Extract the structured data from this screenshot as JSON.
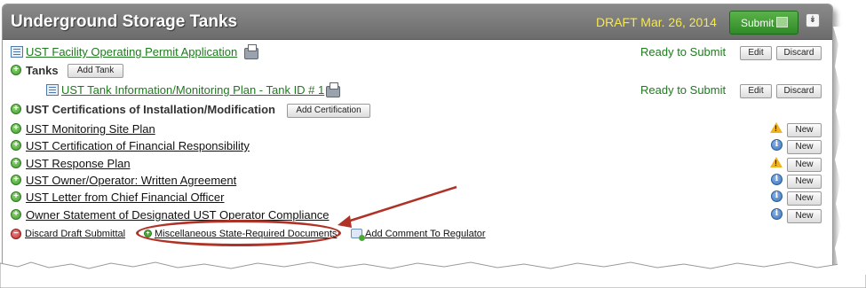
{
  "header": {
    "title": "Underground Storage Tanks",
    "draft_label": "DRAFT Mar. 26, 2014",
    "submit_label": "Submit",
    "collapse_icon": "double-chevron-down-icon"
  },
  "facility_permit": {
    "link": "UST Facility Operating Permit Application",
    "status": "Ready to Submit",
    "edit_label": "Edit",
    "discard_label": "Discard"
  },
  "tanks": {
    "label": "Tanks",
    "add_label": "Add Tank",
    "item": {
      "link": "UST Tank Information/Monitoring Plan - Tank ID # 1",
      "status": "Ready to Submit",
      "edit_label": "Edit",
      "discard_label": "Discard"
    }
  },
  "certifications": {
    "label": "UST Certifications of Installation/Modification",
    "add_label": "Add Certification"
  },
  "documents": [
    {
      "label": "UST Monitoring Site Plan",
      "icon": "warning-icon",
      "button": "New"
    },
    {
      "label": "UST Certification of Financial Responsibility",
      "icon": "info-icon",
      "button": "New"
    },
    {
      "label": "UST Response Plan",
      "icon": "warning-icon",
      "button": "New"
    },
    {
      "label": "UST Owner/Operator: Written Agreement",
      "icon": "info-icon",
      "button": "New"
    },
    {
      "label": "UST Letter from Chief Financial Officer",
      "icon": "info-icon",
      "button": "New"
    },
    {
      "label": "Owner Statement of Designated UST Operator Compliance",
      "icon": "info-icon",
      "button": "New"
    }
  ],
  "footer": {
    "discard_draft": "Discard Draft Submittal",
    "misc_docs": "Miscellaneous State-Required Documents",
    "add_comment": "Add Comment To Regulator"
  },
  "colors": {
    "header_bg": "#7a7a7a",
    "draft_text": "#f7e94a",
    "submit_bg": "#3f9a33",
    "link_green": "#1f7a1f",
    "annotation_red": "#b03226"
  }
}
